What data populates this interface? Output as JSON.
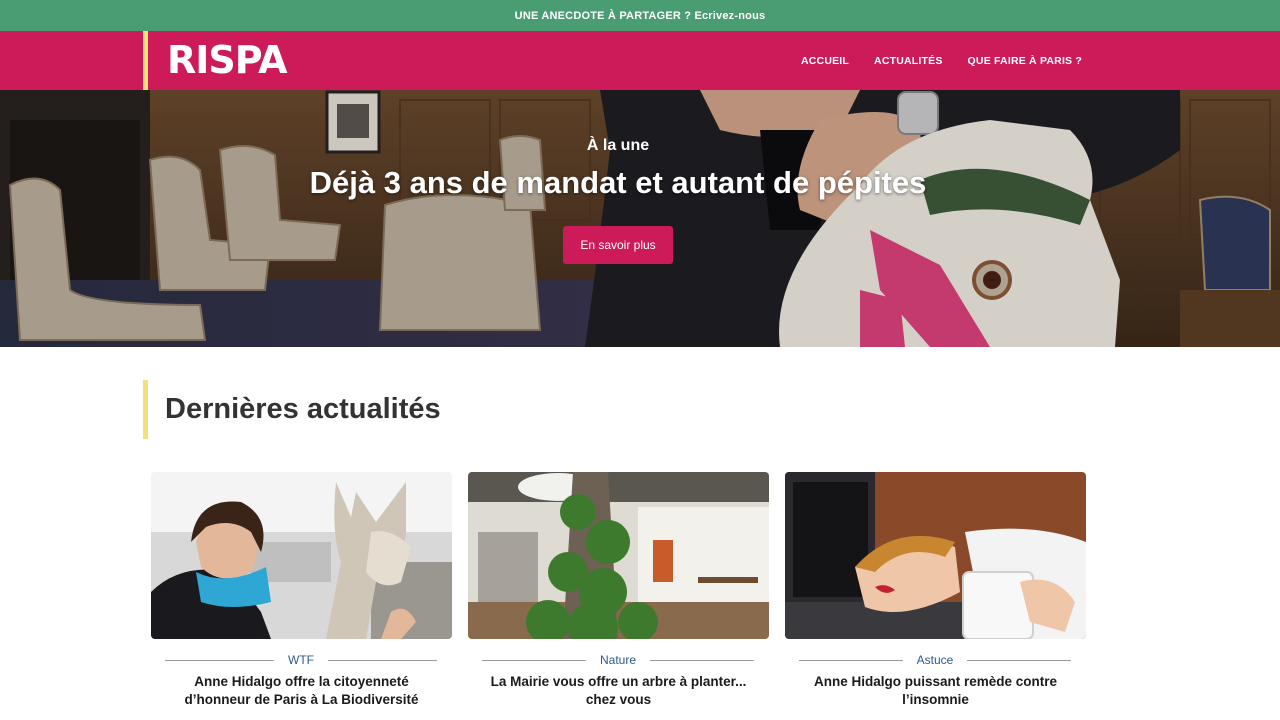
{
  "topbar": {
    "text": "UNE ANECDOTE À PARTAGER ? Ecrivez-nous"
  },
  "header": {
    "logo": "RISPA",
    "nav": [
      "ACCUEIL",
      "ACTUALITÉS",
      "QUE FAIRE À PARIS ?"
    ]
  },
  "hero": {
    "kicker": "À la une",
    "title": "Déjà 3 ans de mandat et autant de pépites",
    "button": "En savoir plus"
  },
  "section": {
    "title": "Dernières actualités"
  },
  "cards": [
    {
      "category": "WTF",
      "title": "Anne Hidalgo offre la citoyenneté d’honneur de Paris à La Biodiversité"
    },
    {
      "category": "Nature",
      "title": "La Mairie vous offre un arbre à planter... chez vous"
    },
    {
      "category": "Astuce",
      "title": "Anne Hidalgo puissant remède contre l’insomnie"
    }
  ],
  "colors": {
    "topbar": "#4a9c72",
    "brand": "#cd1b5a",
    "accent": "#f3e07d",
    "category": "#2c5a8c"
  }
}
